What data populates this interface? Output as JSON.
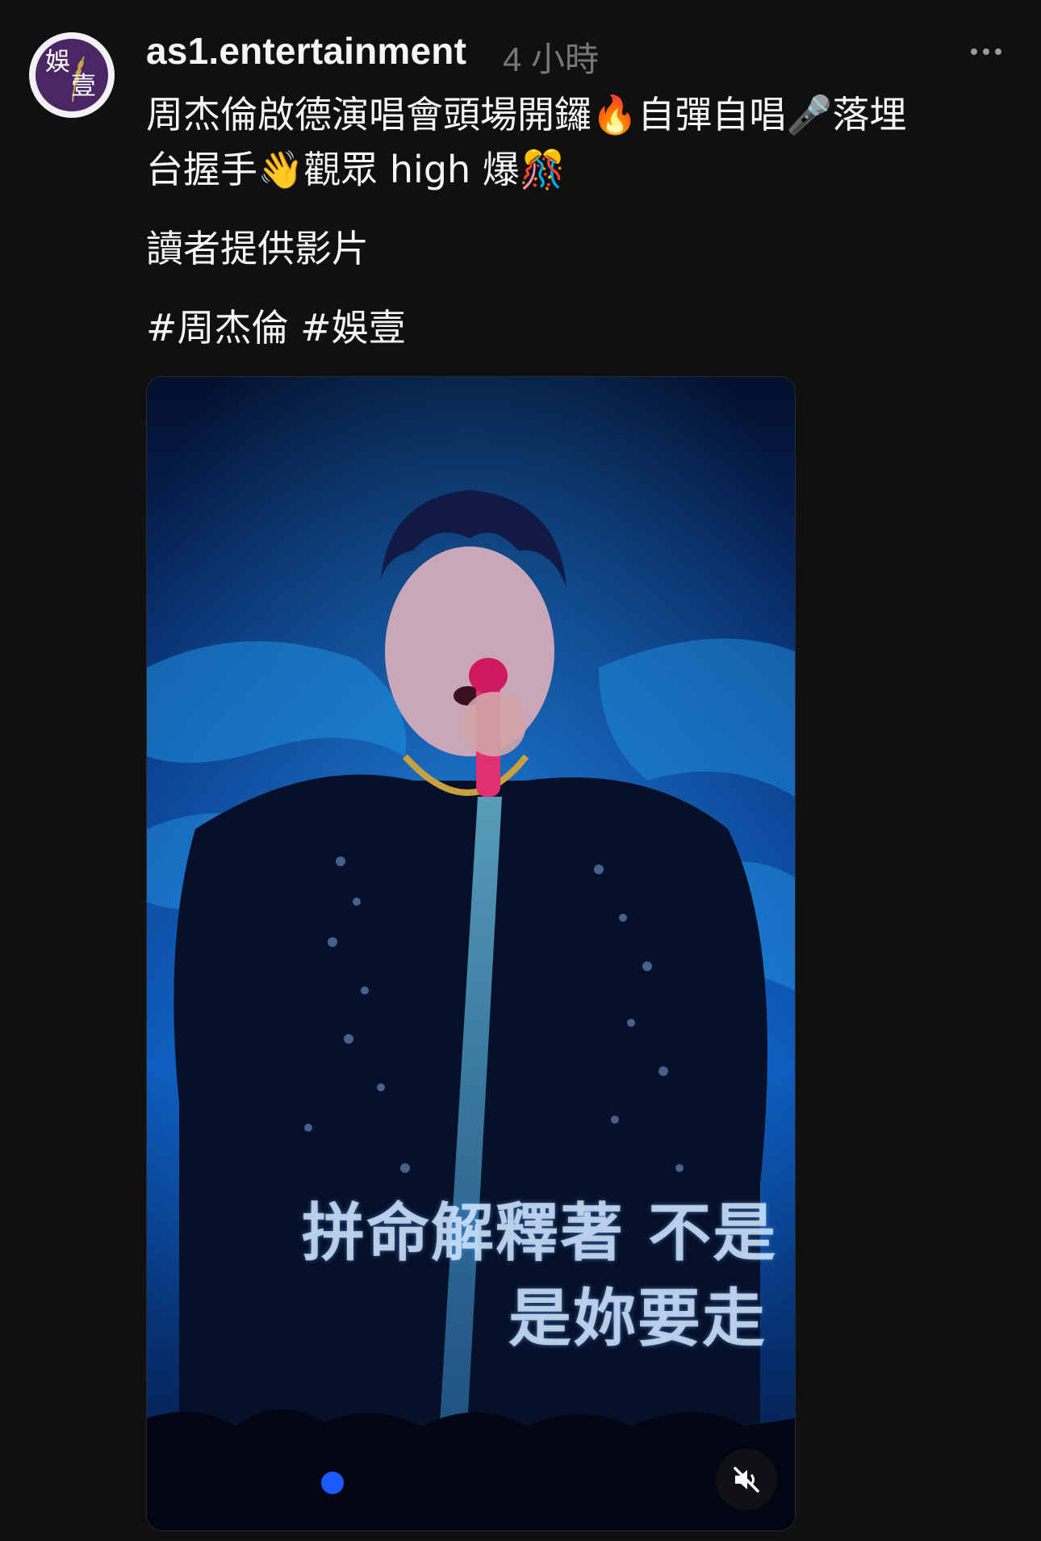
{
  "post": {
    "avatar_text_1": "娛",
    "avatar_text_2": "壹",
    "username": "as1.entertainment",
    "timestamp": "4 小時",
    "more_icon": "more-horizontal-icon",
    "caption_line_1": "周杰倫啟德演唱會頭場開鑼🔥自彈自唱🎤落埋",
    "caption_line_2": "台握手👋觀眾 high 爆🎊",
    "caption_line_3": "讀者提供影片",
    "caption_line_4": "#周杰倫 #娛壹"
  },
  "video": {
    "subtitle_line_1": "拼命解釋著 不是",
    "subtitle_line_2": "是妳要走",
    "mute_icon": "speaker-muted-icon"
  },
  "colors": {
    "background": "#101010",
    "text_primary": "#f3f5f7",
    "text_secondary": "#777777",
    "avatar_purple": "#4b2664",
    "stage_blue": "#0a62c8"
  }
}
